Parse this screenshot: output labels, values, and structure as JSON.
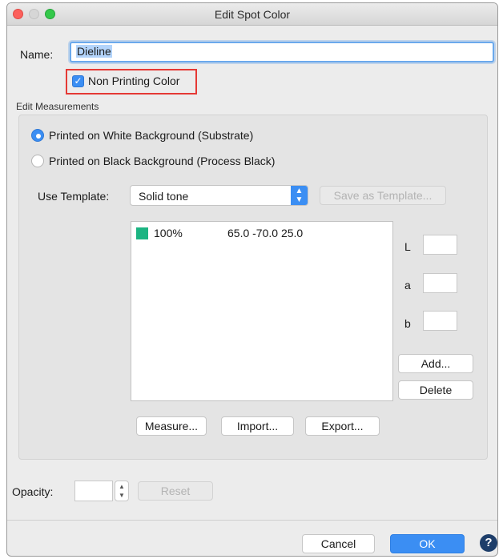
{
  "window": {
    "title": "Edit Spot Color"
  },
  "name": {
    "label": "Name:",
    "value": "Dieline"
  },
  "non_printing": {
    "label": "Non Printing Color",
    "checked": true,
    "check_glyph": "✓"
  },
  "measurements": {
    "group_label": "Edit Measurements",
    "radio_white": {
      "label": "Printed on White Background (Substrate)",
      "selected": true
    },
    "radio_black": {
      "label": "Printed on Black Background (Process Black)",
      "selected": false
    },
    "template": {
      "label": "Use Template:",
      "value": "Solid tone",
      "save_label": "Save as Template..."
    },
    "list": [
      {
        "percent": "100%",
        "lab": "65.0 -70.0 25.0",
        "swatch_color": "#1cb482"
      }
    ],
    "channels": {
      "l": "L",
      "a": "a",
      "b": "b"
    },
    "add_label": "Add...",
    "delete_label": "Delete",
    "measure_label": "Measure...",
    "import_label": "Import...",
    "export_label": "Export..."
  },
  "opacity": {
    "label": "Opacity:",
    "value": "",
    "reset_label": "Reset"
  },
  "footer": {
    "cancel_label": "Cancel",
    "ok_label": "OK",
    "help_glyph": "?"
  },
  "colors": {
    "accent": "#3b8ef3",
    "highlight_box": "#e53935",
    "help": "#1e3e6a"
  }
}
